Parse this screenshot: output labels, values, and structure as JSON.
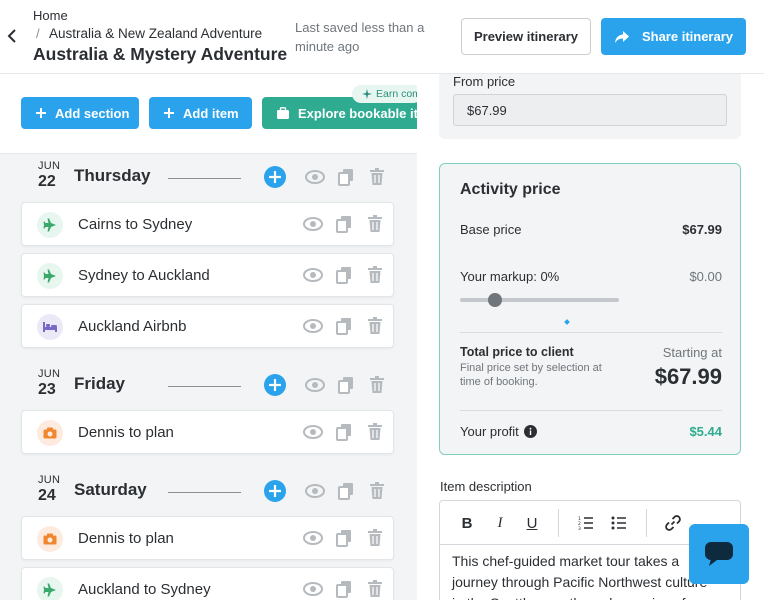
{
  "header": {
    "breadcrumb_home": "Home",
    "breadcrumb_separator": "/",
    "breadcrumb_parent": "Australia & New Zealand Adventure",
    "title": "Australia & Mystery Adventure",
    "saved_status": "Last saved less than a minute ago",
    "preview_label": "Preview itinerary",
    "share_label": "Share itinerary"
  },
  "toolbar": {
    "add_section_label": "Add section",
    "add_item_label": "Add item",
    "explore_label": "Explore bookable items",
    "earn_badge": "Earn commission"
  },
  "days": [
    {
      "month": "JUN",
      "day": "22",
      "name": "Thursday",
      "items": [
        {
          "label": "Cairns to Sydney",
          "icon": "airplane-icon"
        },
        {
          "label": "Sydney to Auckland",
          "icon": "airplane-icon"
        },
        {
          "label": "Auckland Airbnb",
          "icon": "bed-icon"
        }
      ]
    },
    {
      "month": "JUN",
      "day": "23",
      "name": "Friday",
      "items": [
        {
          "label": "Dennis to plan",
          "icon": "camera-icon"
        }
      ]
    },
    {
      "month": "JUN",
      "day": "24",
      "name": "Saturday",
      "items": [
        {
          "label": "Dennis to plan",
          "icon": "camera-icon"
        },
        {
          "label": "Auckland to Sydney",
          "icon": "airplane-icon"
        }
      ]
    }
  ],
  "from_price": {
    "label": "From price",
    "value": "$67.99"
  },
  "activity_price": {
    "title": "Activity price",
    "base_label": "Base price",
    "base_value": "$67.99",
    "markup_label": "Your markup:  0%",
    "markup_value": "$0.00",
    "markup_percent": 0,
    "total_label": "Total price to client",
    "total_note": "Final price set by selection at time of booking.",
    "starting_at": "Starting at",
    "total_value": "$67.99",
    "profit_label": "Your profit",
    "profit_value": "$5.44"
  },
  "description": {
    "label": "Item description",
    "text": "This chef-guided market tour takes a journey through Pacific Northwest culture in the Seattle area through a series of"
  },
  "colors": {
    "accent_blue": "#2aa3ec",
    "accent_green": "#2eab91",
    "plane_icon_bg": "#e7f6ee",
    "bed_icon_bg": "#ece9f7",
    "camera_icon_bg": "#fdebe0"
  }
}
